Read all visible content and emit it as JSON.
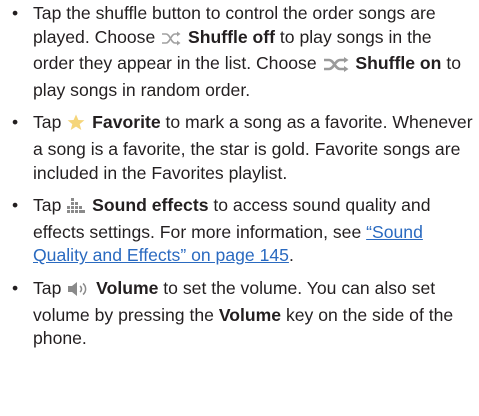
{
  "items": [
    {
      "p1": "Tap the shuffle button to control the order songs are played. Choose",
      "icon1": "shuffle-off-icon",
      "b1": "Shuffle off",
      "p2": "to play songs in the order they appear in the list. Choose",
      "icon2": "shuffle-on-icon",
      "b2": "Shuffle on",
      "p3": "to play songs in random order."
    },
    {
      "p1": "Tap",
      "icon": "star-icon",
      "b1": "Favorite",
      "p2": "to mark a song as a favorite. Whenever a song is a favorite, the star is gold. Favorite songs are included in the Favorites playlist."
    },
    {
      "p1": "Tap",
      "icon": "sound-effects-icon",
      "b1": "Sound effects",
      "p2": "to access sound quality and effects settings. For more information, see",
      "link": "“Sound Quality and Effects” on page 145",
      "p3": "."
    },
    {
      "p1": "Tap",
      "icon": "volume-icon",
      "b1": "Volume",
      "p2": "to set the volume. You can also set volume by pressing the",
      "b2": "Volume",
      "p3": "key on the side of the phone."
    }
  ],
  "colors": {
    "text": "#231f20",
    "link": "#2a6ac0",
    "star": "#f5d57a",
    "icon_gray": "#8a8a8a"
  }
}
